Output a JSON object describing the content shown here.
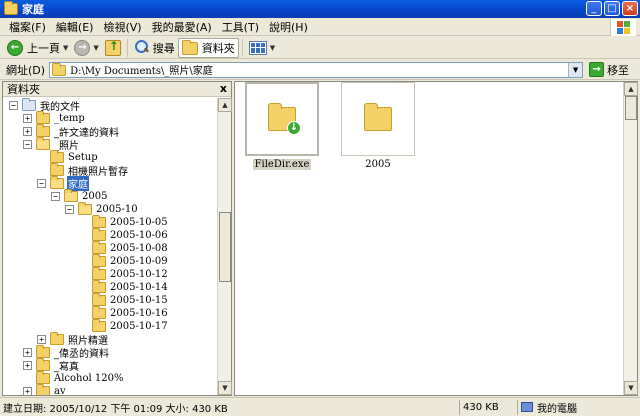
{
  "window": {
    "title": "家庭"
  },
  "menu": [
    "檔案(F)",
    "編輯(E)",
    "檢視(V)",
    "我的最愛(A)",
    "工具(T)",
    "說明(H)"
  ],
  "toolbar": {
    "back_label": "上一頁",
    "search_label": "搜尋",
    "folders_label": "資料夾"
  },
  "address": {
    "label": "網址(D)",
    "path": "D:\\My Documents\\_照片\\家庭",
    "go_label": "移至"
  },
  "left_pane": {
    "title": "資料夾",
    "close": "x",
    "tree": [
      {
        "label": "我的文件",
        "level": 0,
        "expander": "minus",
        "icon": "documents-folder-icon",
        "serif": false,
        "selected": false
      },
      {
        "label": "_temp",
        "level": 1,
        "expander": "plus",
        "icon": "folder-icon",
        "serif": true,
        "selected": false
      },
      {
        "label": "_許文達的資料",
        "level": 1,
        "expander": "plus",
        "icon": "folder-icon",
        "serif": false,
        "selected": false
      },
      {
        "label": "_照片",
        "level": 1,
        "expander": "minus",
        "icon": "open-folder-icon",
        "serif": false,
        "selected": false
      },
      {
        "label": "Setup",
        "level": 2,
        "expander": "none",
        "icon": "folder-icon",
        "serif": true,
        "selected": false
      },
      {
        "label": "相機照片暫存",
        "level": 2,
        "expander": "none",
        "icon": "folder-icon",
        "serif": false,
        "selected": false
      },
      {
        "label": "家庭",
        "level": 2,
        "expander": "minus",
        "icon": "open-folder-icon",
        "serif": false,
        "selected": true
      },
      {
        "label": "2005",
        "level": 3,
        "expander": "minus",
        "icon": "open-folder-icon",
        "serif": true,
        "selected": false
      },
      {
        "label": "2005-10",
        "level": 4,
        "expander": "minus",
        "icon": "open-folder-icon",
        "serif": true,
        "selected": false
      },
      {
        "label": "2005-10-05",
        "level": 5,
        "expander": "none",
        "icon": "folder-icon",
        "serif": true,
        "selected": false
      },
      {
        "label": "2005-10-06",
        "level": 5,
        "expander": "none",
        "icon": "folder-icon",
        "serif": true,
        "selected": false
      },
      {
        "label": "2005-10-08",
        "level": 5,
        "expander": "none",
        "icon": "folder-icon",
        "serif": true,
        "selected": false
      },
      {
        "label": "2005-10-09",
        "level": 5,
        "expander": "none",
        "icon": "folder-icon",
        "serif": true,
        "selected": false
      },
      {
        "label": "2005-10-12",
        "level": 5,
        "expander": "none",
        "icon": "folder-icon",
        "serif": true,
        "selected": false
      },
      {
        "label": "2005-10-14",
        "level": 5,
        "expander": "none",
        "icon": "folder-icon",
        "serif": true,
        "selected": false
      },
      {
        "label": "2005-10-15",
        "level": 5,
        "expander": "none",
        "icon": "folder-icon",
        "serif": true,
        "selected": false
      },
      {
        "label": "2005-10-16",
        "level": 5,
        "expander": "none",
        "icon": "folder-icon",
        "serif": true,
        "selected": false
      },
      {
        "label": "2005-10-17",
        "level": 5,
        "expander": "none",
        "icon": "folder-icon",
        "serif": true,
        "selected": false
      },
      {
        "label": "照片精選",
        "level": 2,
        "expander": "plus",
        "icon": "folder-icon",
        "serif": false,
        "selected": false
      },
      {
        "label": "_偉丞的資料",
        "level": 1,
        "expander": "plus",
        "icon": "folder-icon",
        "serif": false,
        "selected": false
      },
      {
        "label": "_寫真",
        "level": 1,
        "expander": "plus",
        "icon": "folder-icon",
        "serif": false,
        "selected": false
      },
      {
        "label": "Alcohol 120%",
        "level": 1,
        "expander": "none",
        "icon": "folder-icon",
        "serif": true,
        "selected": false
      },
      {
        "label": "av",
        "level": 1,
        "expander": "plus",
        "icon": "folder-icon",
        "serif": true,
        "selected": false
      }
    ]
  },
  "items": [
    {
      "label": "FileDir.exe",
      "icon": "filedir-exe-icon",
      "selected": true
    },
    {
      "label": "2005",
      "icon": "folder-icon",
      "selected": false
    }
  ],
  "status": {
    "info": "建立日期: 2005/10/12 下午 01:09 大小: 430 KB",
    "size": "430 KB",
    "zone": "我的電腦"
  },
  "colors": {
    "titlebar": "#0846c8",
    "selection": "#316ac5",
    "folder": "#f4d166",
    "chrome": "#ece9d8"
  }
}
